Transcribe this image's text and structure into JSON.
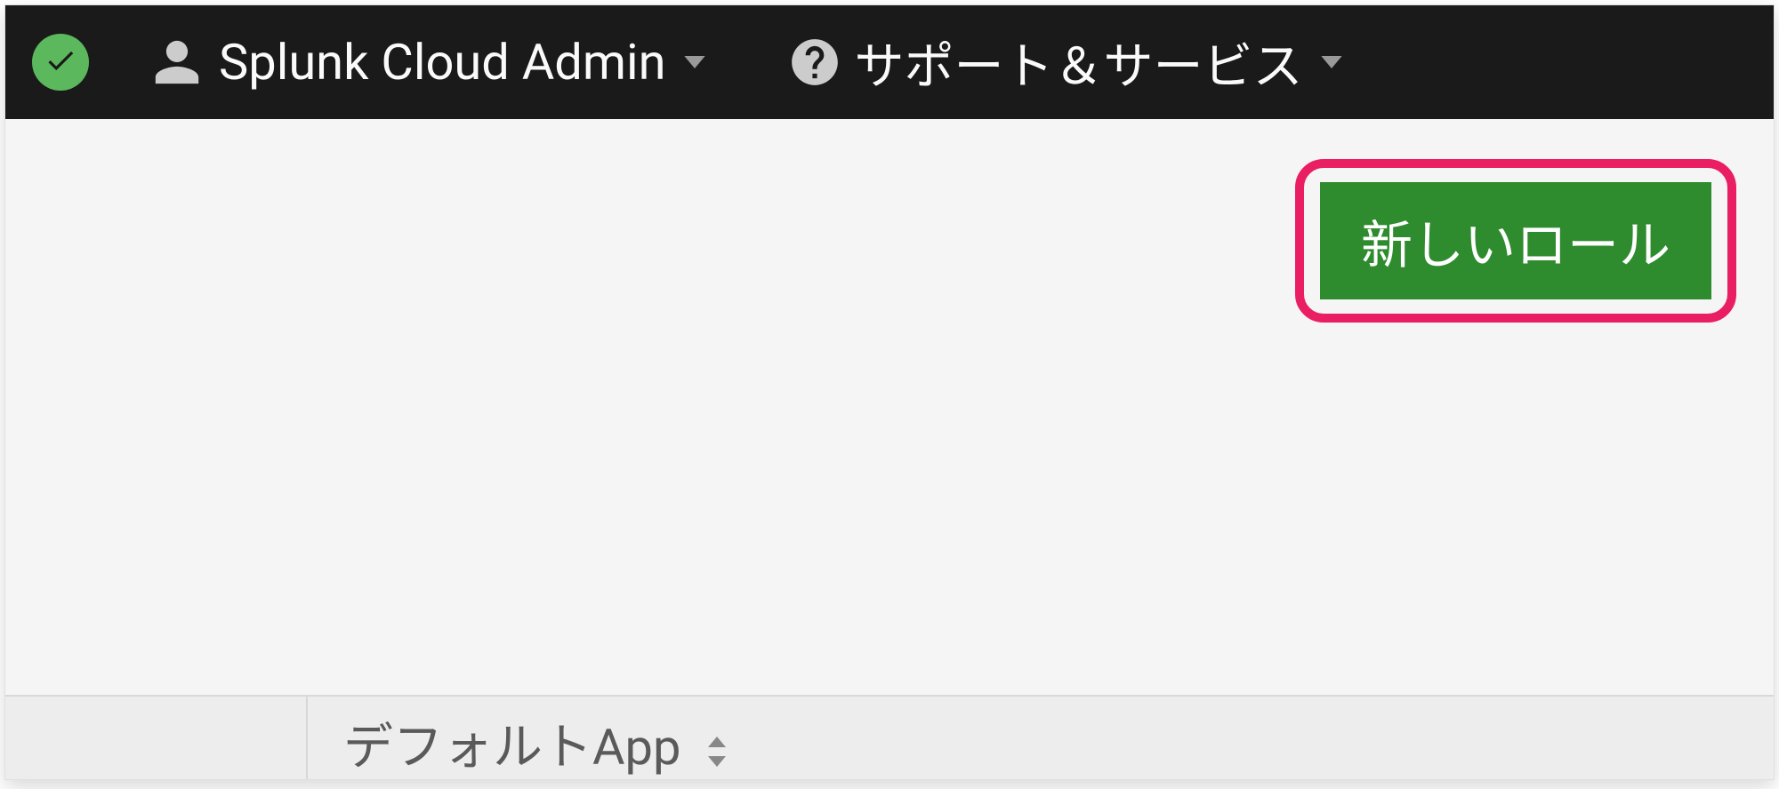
{
  "header": {
    "user_label": "Splunk Cloud Admin",
    "support_label": "サポート＆サービス"
  },
  "content": {
    "new_role_button": "新しいロール"
  },
  "table": {
    "columns": {
      "default_app_label": "デフォルトApp"
    }
  },
  "colors": {
    "header_bg": "#1a1a1a",
    "status_green": "#5CB85C",
    "button_green": "#2E8B2E",
    "highlight_pink": "#E91E63",
    "panel_bg": "#f5f5f5"
  }
}
